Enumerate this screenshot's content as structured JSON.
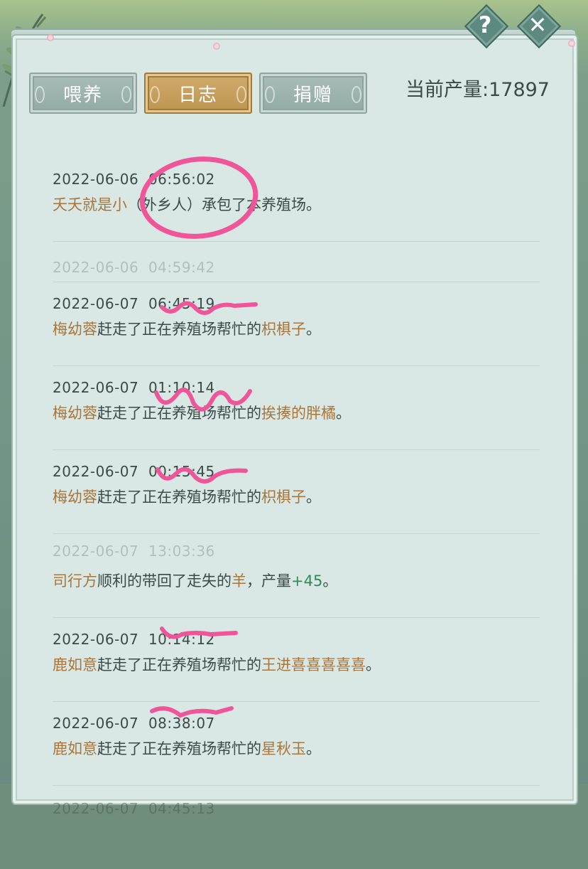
{
  "header": {
    "help_symbol": "?",
    "close_symbol": "✕",
    "output_label": "当前产量:",
    "output_value": "17897"
  },
  "tabs": [
    {
      "label": "喂养",
      "active": false
    },
    {
      "label": "日志",
      "active": true
    },
    {
      "label": "捐赠",
      "active": false
    }
  ],
  "log": [
    {
      "time": "2022-06-06  06:56:02",
      "actor": "夭夭就是小",
      "mid": "（外乡人）承包了本养殖场。",
      "target": "",
      "end": ""
    },
    {
      "ghost": "2022-06-06  04:59:42"
    },
    {
      "time": "2022-06-07  06:45:19",
      "actor": "梅幼蓉",
      "mid": "赶走了正在养殖场帮忙的",
      "target": "枳椇子",
      "end": "。"
    },
    {
      "time": "2022-06-07  01:10:14",
      "actor": "梅幼蓉",
      "mid": "赶走了正在养殖场帮忙的",
      "target": "挨揍的胖橘",
      "end": "。"
    },
    {
      "time": "2022-06-07  00:15:45",
      "actor": "梅幼蓉",
      "mid": "赶走了正在养殖场帮忙的",
      "target": "枳椇子",
      "end": "。"
    },
    {
      "ghost": "2022-06-07  13:03:36",
      "actor": "司行方",
      "mid": "顺利的带回了走失的",
      "target": "羊",
      "tail": "，产量",
      "plus": "+45",
      "end": "。"
    },
    {
      "time": "2022-06-07  10:14:12",
      "actor": "鹿如意",
      "mid": "赶走了正在养殖场帮忙的",
      "target": "王进喜喜喜喜喜",
      "end": "。"
    },
    {
      "time": "2022-06-07  08:38:07",
      "actor": "鹿如意",
      "mid": "赶走了正在养殖场帮忙的",
      "target": "星秋玉",
      "end": "。"
    },
    {
      "ghost": "2022-06-07  04:45:13"
    }
  ],
  "colors": {
    "panel": "#d9e8e4",
    "tab_active": "#c49b58",
    "tab_inactive": "#9cb1ab",
    "highlight_name": "#a8763c",
    "plus_value": "#2f8a5a",
    "scribble": "#f0559a"
  },
  "icons": [
    "help-icon",
    "close-icon"
  ]
}
